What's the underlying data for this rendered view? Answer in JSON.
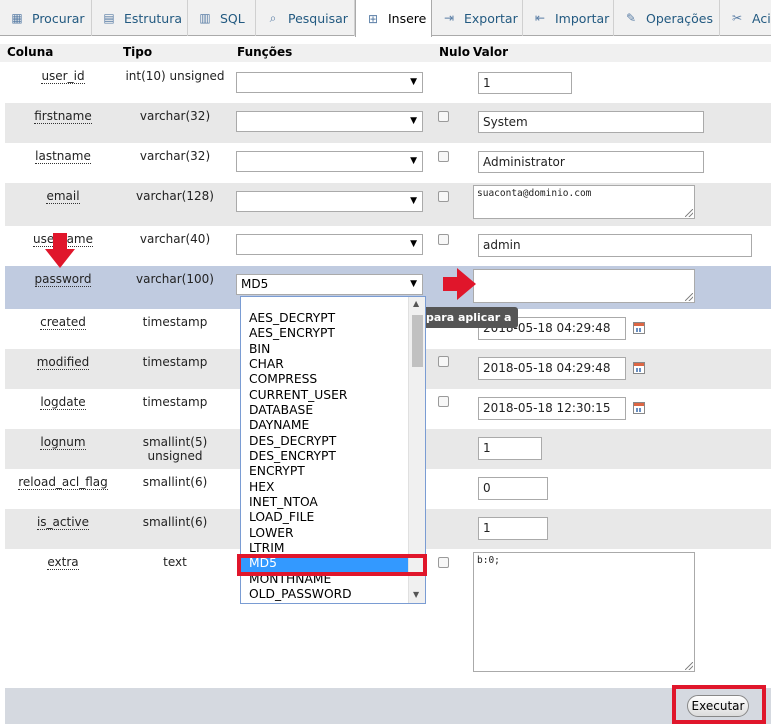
{
  "tabs": [
    {
      "label": "Procurar",
      "icon": "browse-icon",
      "active": false
    },
    {
      "label": "Estrutura",
      "icon": "structure-icon",
      "active": false
    },
    {
      "label": "SQL",
      "icon": "sql-icon",
      "active": false
    },
    {
      "label": "Pesquisar",
      "icon": "search-icon",
      "active": false
    },
    {
      "label": "Insere",
      "icon": "insert-icon",
      "active": true
    },
    {
      "label": "Exportar",
      "icon": "export-icon",
      "active": false
    },
    {
      "label": "Importar",
      "icon": "import-icon",
      "active": false
    },
    {
      "label": "Operações",
      "icon": "wrench-icon",
      "active": false
    },
    {
      "label": "Aci",
      "icon": "triggers-icon",
      "active": false
    }
  ],
  "header": {
    "coluna": "Coluna",
    "tipo": "Tipo",
    "funcoes": "Funções",
    "nulo": "Nulo",
    "valor": "Valor"
  },
  "fields": [
    {
      "name": "user_id",
      "type": "int(10) unsigned",
      "function": "",
      "value": "1"
    },
    {
      "name": "firstname",
      "type": "varchar(32)",
      "function": "",
      "value": "System"
    },
    {
      "name": "lastname",
      "type": "varchar(32)",
      "function": "",
      "value": "Administrator"
    },
    {
      "name": "email",
      "type": "varchar(128)",
      "function": "",
      "value": "suaconta@dominio.com"
    },
    {
      "name": "username",
      "type": "varchar(40)",
      "function": "",
      "value": "admin"
    },
    {
      "name": "password",
      "type": "varchar(100)",
      "function": "MD5",
      "value": ""
    },
    {
      "name": "created",
      "type": "timestamp",
      "function": "",
      "value": "2018-05-18 04:29:48"
    },
    {
      "name": "modified",
      "type": "timestamp",
      "function": "",
      "value": "2018-05-18 04:29:48"
    },
    {
      "name": "logdate",
      "type": "timestamp",
      "function": "",
      "value": "2018-05-18 12:30:15"
    },
    {
      "name": "lognum",
      "type": "smallint(5) unsigned",
      "function": "",
      "value": "1"
    },
    {
      "name": "reload_acl_flag",
      "type": "smallint(6)",
      "function": "",
      "value": "0"
    },
    {
      "name": "is_active",
      "type": "smallint(6)",
      "function": "",
      "value": "1"
    },
    {
      "name": "extra",
      "type": "text",
      "function": "",
      "value": "b:0;"
    }
  ],
  "dropdown_options": [
    "AES_DECRYPT",
    "AES_ENCRYPT",
    "BIN",
    "CHAR",
    "COMPRESS",
    "CURRENT_USER",
    "DATABASE",
    "DAYNAME",
    "DES_DECRYPT",
    "DES_ENCRYPT",
    "ENCRYPT",
    "HEX",
    "INET_NTOA",
    "LOAD_FILE",
    "LOWER",
    "LTRIM",
    "MD5",
    "MONTHNAME",
    "OLD_PASSWORD"
  ],
  "dropdown_selected": "MD5",
  "tooltip": "para aplicar a",
  "execute_label": "Executar",
  "colors": {
    "annotation_red": "#e0162b",
    "highlight_blue": "#3399ff",
    "selected_row": "#c0cbe0"
  }
}
